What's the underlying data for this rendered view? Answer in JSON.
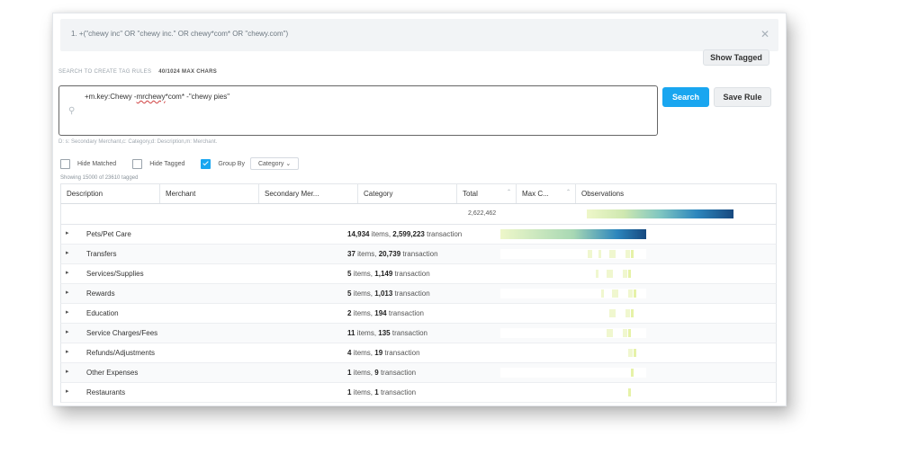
{
  "rule_bar": {
    "text": "1. +(\"chewy inc\" OR \"chewy inc.\" OR chewy*com* OR \"chewy.com\")"
  },
  "buttons": {
    "show_tagged": "Show Tagged",
    "search": "Search",
    "save_rule": "Save Rule"
  },
  "section": {
    "label": "SEARCH TO CREATE TAG RULES",
    "chars": "40/1024 MAX CHARS"
  },
  "search": {
    "query_prefix": "+m.key:Chewy -",
    "query_underlined": "mrchewy",
    "query_suffix": "*com* -\"chewy pies\""
  },
  "hint": "D: s: Secondary Merchant,c: Category,d: Description,m: Merchant.",
  "options": {
    "hide_matched": "Hide Matched",
    "hide_tagged": "Hide Tagged",
    "group_by": "Group By",
    "group_by_value": "Category"
  },
  "showing": "Showing 15000 of 23610 tagged",
  "columns": [
    "Description",
    "Merchant",
    "Secondary Mer...",
    "Category",
    "Total",
    "Max C...",
    "Observations"
  ],
  "total_value": "2,622,462",
  "rows": [
    {
      "name": "Pets/Pet Care",
      "items": "14,934",
      "items_unit": "items,",
      "tx": "2,599,223",
      "tx_unit": "transaction"
    },
    {
      "name": "Transfers",
      "items": "37",
      "items_unit": "items,",
      "tx": "20,739",
      "tx_unit": "transaction"
    },
    {
      "name": "Services/Supplies",
      "items": "5",
      "items_unit": "items,",
      "tx": "1,149",
      "tx_unit": "transaction"
    },
    {
      "name": "Rewards",
      "items": "5",
      "items_unit": "items,",
      "tx": "1,013",
      "tx_unit": "transaction"
    },
    {
      "name": "Education",
      "items": "2",
      "items_unit": "items,",
      "tx": "194",
      "tx_unit": "transaction"
    },
    {
      "name": "Service Charges/Fees",
      "items": "11",
      "items_unit": "items,",
      "tx": "135",
      "tx_unit": "transaction"
    },
    {
      "name": "Refunds/Adjustments",
      "items": "4",
      "items_unit": "items,",
      "tx": "19",
      "tx_unit": "transaction"
    },
    {
      "name": "Other Expenses",
      "items": "1",
      "items_unit": "items,",
      "tx": "9",
      "tx_unit": "transaction"
    },
    {
      "name": "Restaurants",
      "items": "1",
      "items_unit": "items,",
      "tx": "1",
      "tx_unit": "transaction"
    }
  ],
  "icons": {
    "close": "close-icon",
    "search": "search-icon",
    "expand": "chevron-right-icon",
    "sort": "sort-icon"
  },
  "colors": {
    "accent": "#19a6f0",
    "heat_low": "#eef7c9",
    "heat_high": "#17497f"
  }
}
